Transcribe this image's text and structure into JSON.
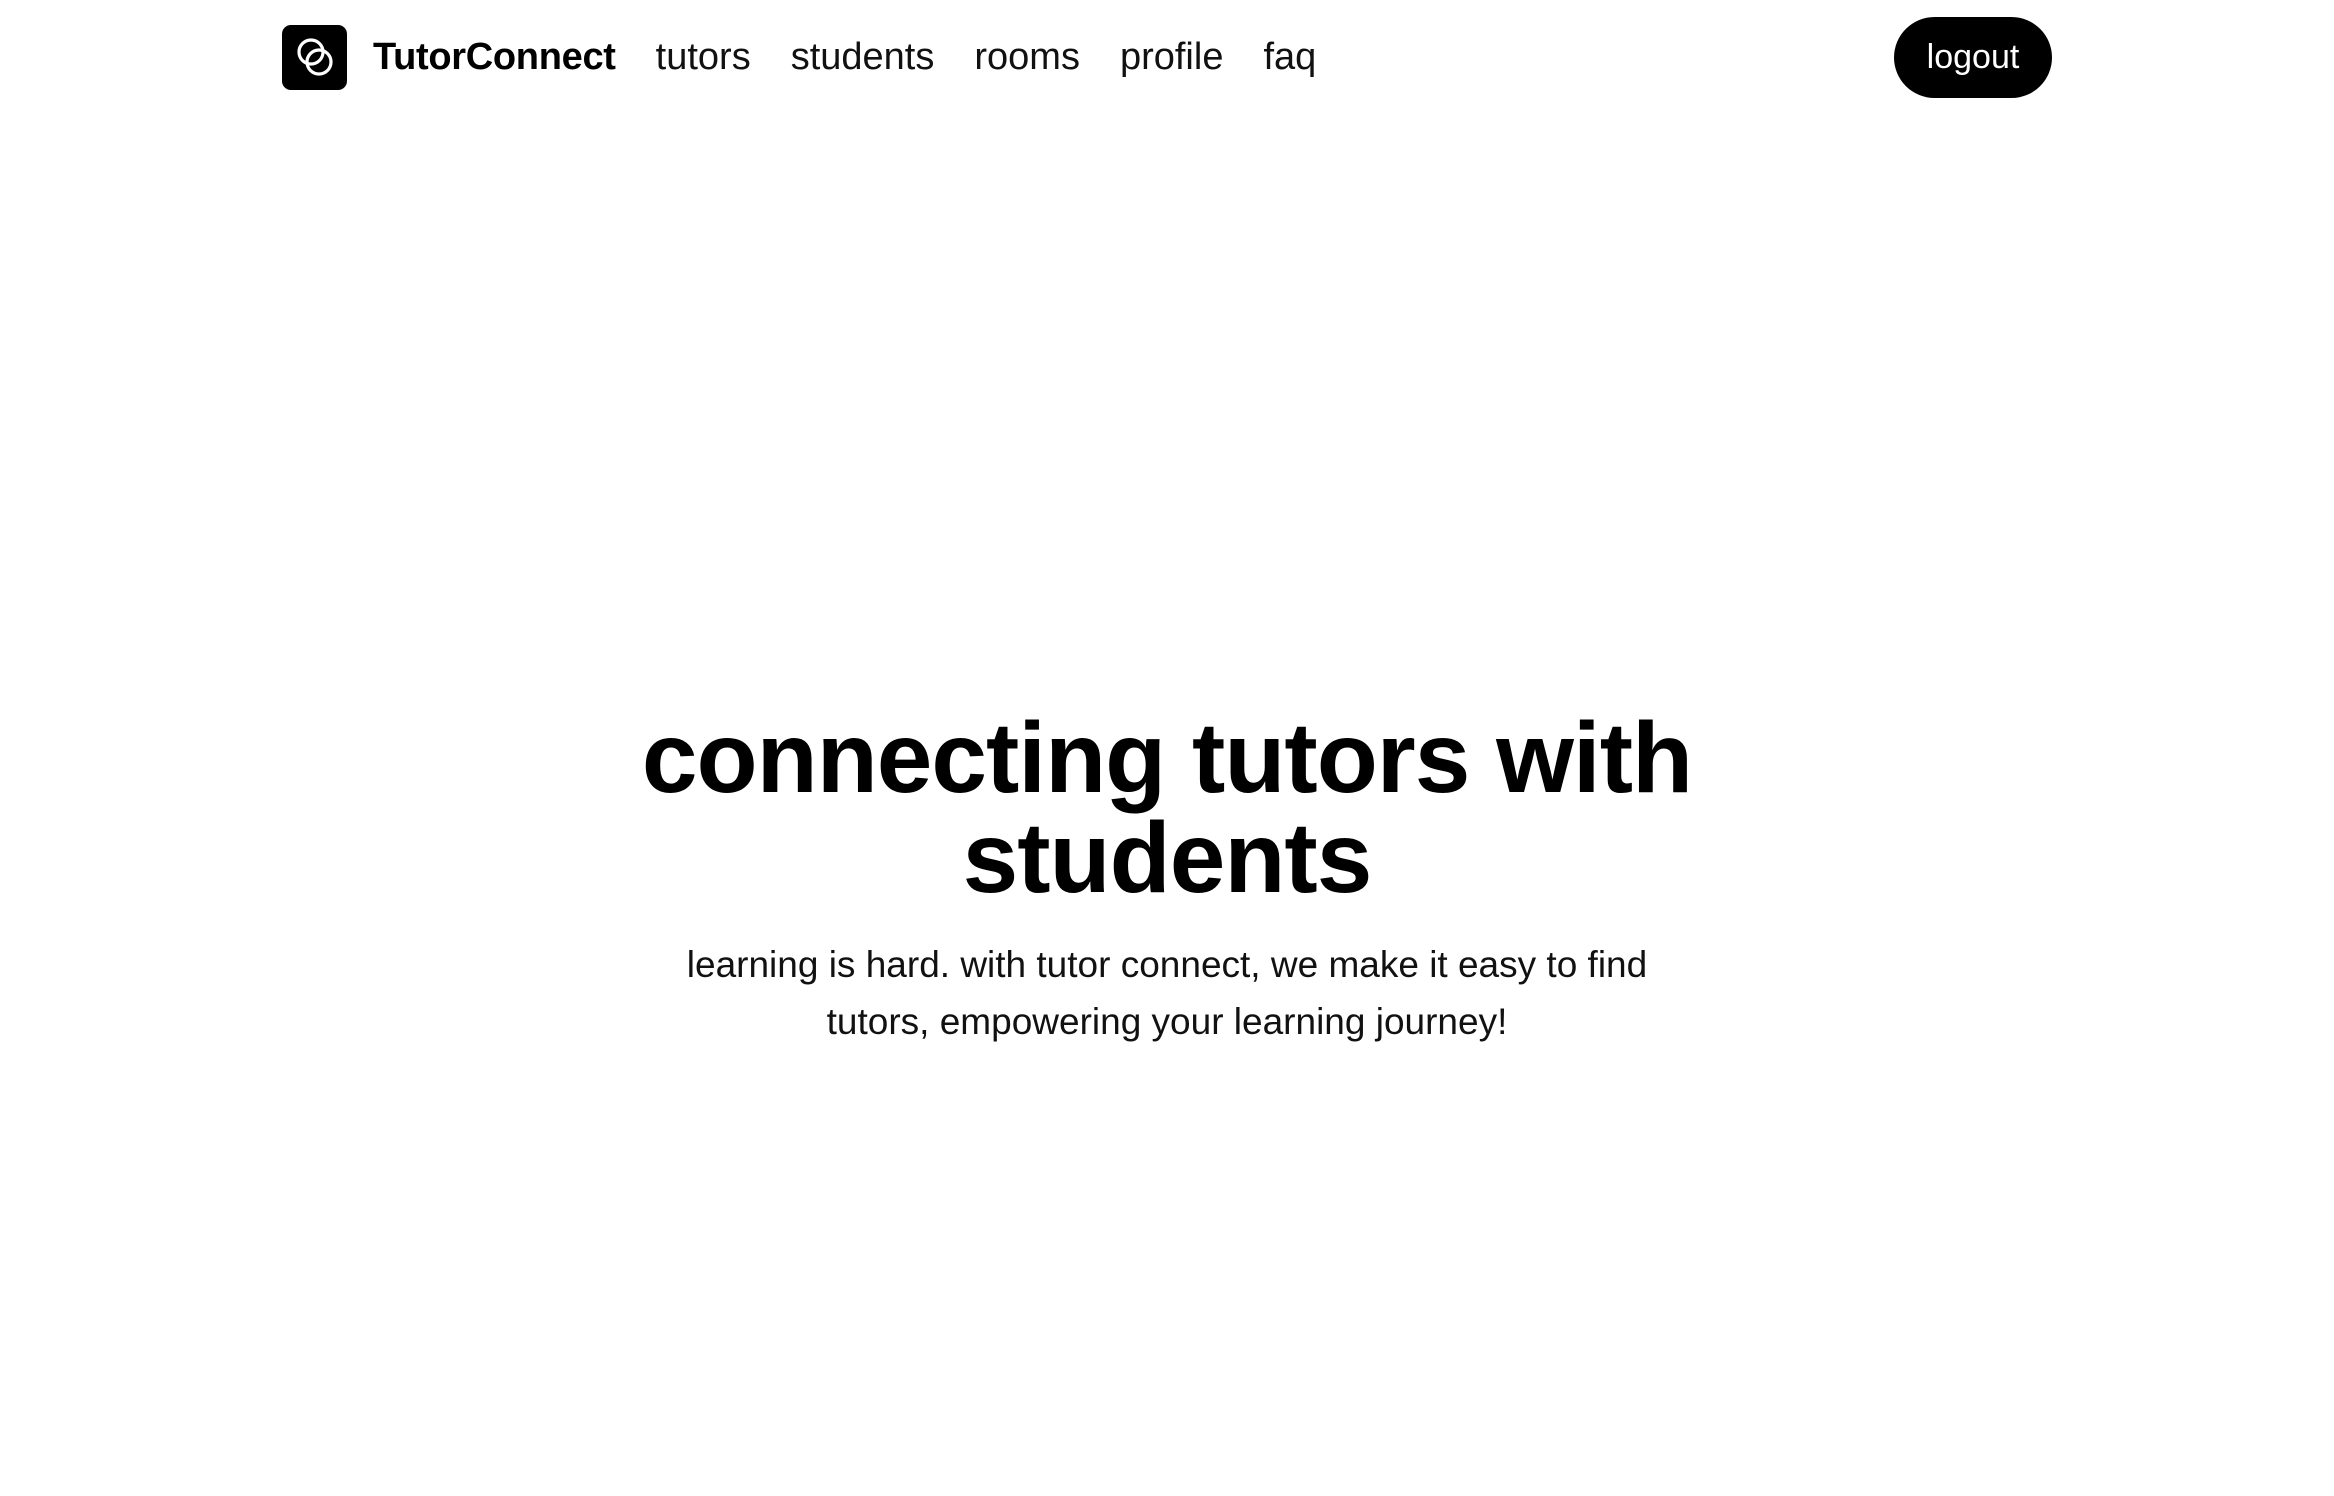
{
  "nav": {
    "brand": "TutorConnect",
    "logo_icon": "interlocked-rings-icon",
    "links": [
      {
        "label": "tutors"
      },
      {
        "label": "students"
      },
      {
        "label": "rooms"
      },
      {
        "label": "profile"
      },
      {
        "label": "faq"
      }
    ],
    "logout_label": "logout"
  },
  "hero": {
    "title": "connecting tutors with students",
    "subtitle": "learning is hard. with tutor connect, we make it easy to find tutors, empowering your learning journey!"
  },
  "colors": {
    "background": "#ffffff",
    "text": "#000000",
    "button_bg": "#000000",
    "button_text": "#ffffff"
  }
}
